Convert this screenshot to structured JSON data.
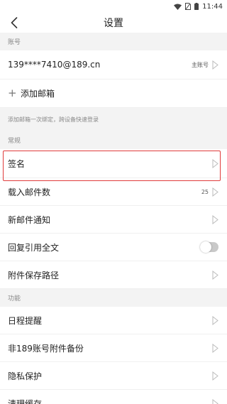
{
  "status_bar": {
    "time": "11:44"
  },
  "header": {
    "title": "设置"
  },
  "account_section": {
    "header": "账号",
    "email": "139****7410@189.cn",
    "primary_badge": "主账号",
    "add_mailbox_label": "添加邮箱",
    "note": "添加邮箱一次绑定，跨设备快速登录"
  },
  "general_section": {
    "header": "常规",
    "items": [
      {
        "label": "签名"
      },
      {
        "label": "载入邮件数",
        "value": "25"
      },
      {
        "label": "新邮件通知"
      },
      {
        "label": "回复引用全文"
      },
      {
        "label": "附件保存路径"
      }
    ]
  },
  "feature_section": {
    "header": "功能",
    "items": [
      {
        "label": "日程提醒"
      },
      {
        "label": "非189账号附件备份"
      },
      {
        "label": "隐私保护"
      },
      {
        "label": "清理缓存"
      }
    ]
  },
  "colors": {
    "highlight": "#e03b3b",
    "section_bg": "#f3f3f3",
    "toggle_off": "#c9c9c9"
  }
}
